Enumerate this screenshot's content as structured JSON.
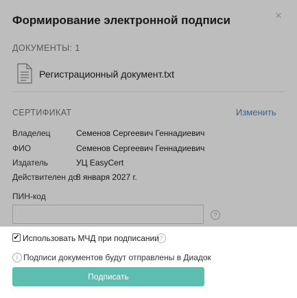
{
  "dialog": {
    "title": "Формирование электронной подписи",
    "close_icon": "×"
  },
  "documents": {
    "header": "ДОКУМЕНТЫ: 1",
    "items": [
      {
        "name": "Регистрационный документ.txt",
        "icon": "document-icon"
      }
    ]
  },
  "certificate": {
    "header": "СЕРТИФИКАТ",
    "change_label": "Изменить",
    "fields": [
      {
        "key": "Владелец",
        "value": "Семенов Сергеевич Геннадиевич"
      },
      {
        "key": "ФИО",
        "value": "Семенов Сергеевич Геннадиевич"
      },
      {
        "key": "Издатель",
        "value": "УЦ EasyCert"
      },
      {
        "key": "Действителен до",
        "value": "8 января 2027 г."
      }
    ]
  },
  "pin": {
    "label": "ПИН-код",
    "value": "",
    "help_icon": "?"
  },
  "mchd": {
    "checked": true,
    "check_mark": "✔",
    "label": "Использовать МЧД при подписании",
    "help_icon": "?"
  },
  "info": {
    "icon": "i",
    "text": "Подписи документов будут отправлены в Диадок"
  },
  "actions": {
    "sign_label": "Подписать"
  },
  "colors": {
    "accent": "#5dbdb1",
    "link": "#4a86c0",
    "overlay": "rgba(0,0,0,0.26)"
  }
}
